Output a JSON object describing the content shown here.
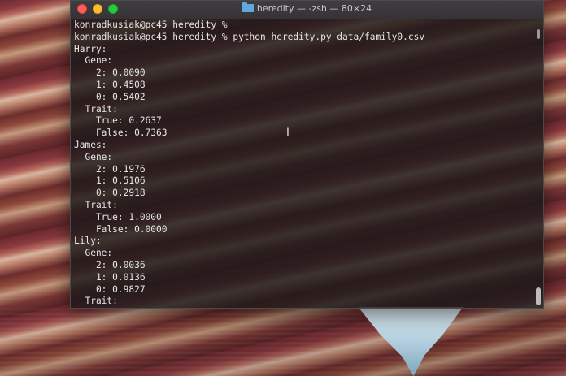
{
  "window": {
    "title": "heredity — -zsh — 80×24"
  },
  "terminal": {
    "lines": [
      "konradkusiak@pc45 heredity %",
      "konradkusiak@pc45 heredity % python heredity.py data/family0.csv",
      "Harry:",
      "  Gene:",
      "    2: 0.0090",
      "    1: 0.4508",
      "    0: 0.5402",
      "  Trait:",
      "    True: 0.2637",
      "    False: 0.7363",
      "James:",
      "  Gene:",
      "    2: 0.1976",
      "    1: 0.5106",
      "    0: 0.2918",
      "  Trait:",
      "    True: 1.0000",
      "    False: 0.0000",
      "Lily:",
      "  Gene:",
      "    2: 0.0036",
      "    1: 0.0136",
      "    0: 0.9827",
      "  Trait:"
    ]
  },
  "icons": {
    "folder": "folder-icon",
    "cursor": "text-cursor-icon"
  },
  "colors": {
    "close": "#fe5f57",
    "minimize": "#febc2e",
    "maximize": "#28c840",
    "terminal_text": "#e6e6e6"
  }
}
